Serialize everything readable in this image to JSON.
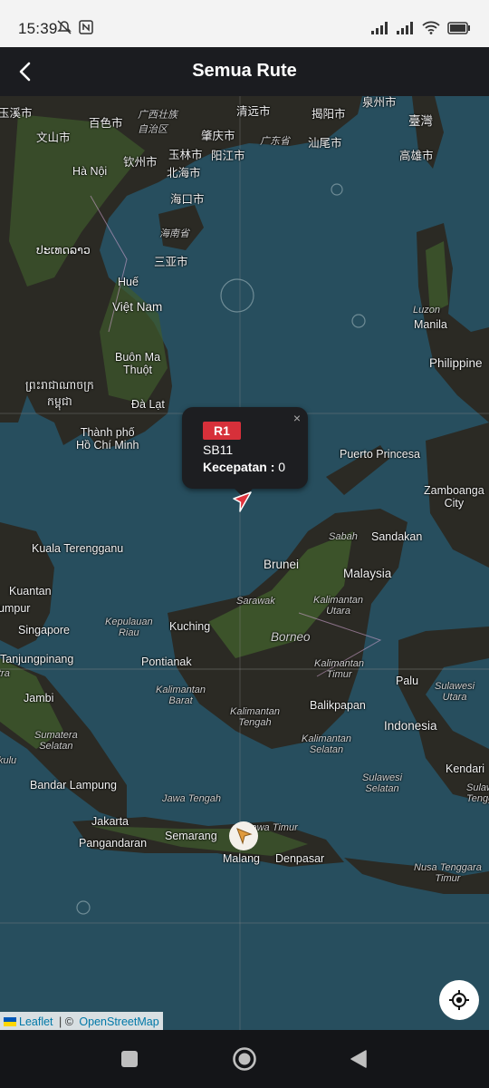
{
  "status_bar": {
    "time": "15:39"
  },
  "app_bar": {
    "title": "Semua Rute"
  },
  "map": {
    "labels": [
      {
        "id": "l1",
        "text": "玉溪市"
      },
      {
        "id": "l2",
        "text": "百色市"
      },
      {
        "id": "l3",
        "text": "广西壮族\n自治区"
      },
      {
        "id": "l4",
        "text": "清远市"
      },
      {
        "id": "l5",
        "text": "揭阳市"
      },
      {
        "id": "l6",
        "text": "泉州市"
      },
      {
        "id": "l7",
        "text": "臺灣"
      },
      {
        "id": "l8",
        "text": "文山市"
      },
      {
        "id": "l9",
        "text": "肇庆市"
      },
      {
        "id": "l10",
        "text": "广东省"
      },
      {
        "id": "l11",
        "text": "汕尾市"
      },
      {
        "id": "l12",
        "text": "玉林市"
      },
      {
        "id": "l13",
        "text": "阳江市"
      },
      {
        "id": "l14",
        "text": "钦州市"
      },
      {
        "id": "l15",
        "text": "北海市"
      },
      {
        "id": "l16",
        "text": "高雄市"
      },
      {
        "id": "l17",
        "text": "Hà Nội"
      },
      {
        "id": "l18",
        "text": "海口市"
      },
      {
        "id": "l19",
        "text": "海南省"
      },
      {
        "id": "l20",
        "text": "ປະເທດລາວ"
      },
      {
        "id": "l21",
        "text": "三亚市"
      },
      {
        "id": "l22",
        "text": "Huế"
      },
      {
        "id": "l23",
        "text": "Việt Nam"
      },
      {
        "id": "l24",
        "text": "Luzon"
      },
      {
        "id": "l25",
        "text": "Manila"
      },
      {
        "id": "l26",
        "text": "Philippine"
      },
      {
        "id": "l27",
        "text": "Buôn Ma\nThuột"
      },
      {
        "id": "l28",
        "text": "ព្រះរាជាណាចក្រ\nកម្ពុជា"
      },
      {
        "id": "l29",
        "text": "Đà Lạt"
      },
      {
        "id": "l30",
        "text": "Thành phố\nHồ Chí Minh"
      },
      {
        "id": "l31",
        "text": "Puerto Princesa"
      },
      {
        "id": "l32",
        "text": "Zamboanga\nCity"
      },
      {
        "id": "l33",
        "text": "Sabah"
      },
      {
        "id": "l34",
        "text": "Sandakan"
      },
      {
        "id": "l35",
        "text": "Kuala Terengganu"
      },
      {
        "id": "l36",
        "text": "Brunei"
      },
      {
        "id": "l37",
        "text": "Malaysia"
      },
      {
        "id": "l38",
        "text": "Kuantan"
      },
      {
        "id": "l39",
        "text": "umpur"
      },
      {
        "id": "l40",
        "text": "Sarawak"
      },
      {
        "id": "l41",
        "text": "Kalimantan\nUtara"
      },
      {
        "id": "l42",
        "text": "Singapore"
      },
      {
        "id": "l43",
        "text": "Kepulauan\nRiau"
      },
      {
        "id": "l44",
        "text": "Kuching"
      },
      {
        "id": "l45",
        "text": "Borneo"
      },
      {
        "id": "l46",
        "text": "Tanjungpinang"
      },
      {
        "id": "l47",
        "text": "Pontianak"
      },
      {
        "id": "l48",
        "text": "Kalimantan\nTimur"
      },
      {
        "id": "l49",
        "text": "tra"
      },
      {
        "id": "l50",
        "text": "Palu"
      },
      {
        "id": "l51",
        "text": "Sulawesi\nUtara"
      },
      {
        "id": "l52",
        "text": "Jambi"
      },
      {
        "id": "l53",
        "text": "Kalimantan\nBarat"
      },
      {
        "id": "l54",
        "text": "Kalimantan\nTengah"
      },
      {
        "id": "l55",
        "text": "Balikpapan"
      },
      {
        "id": "l56",
        "text": "Indonesia"
      },
      {
        "id": "l57",
        "text": "Sumatera\nSelatan"
      },
      {
        "id": "l58",
        "text": "Kalimantan\nSelatan"
      },
      {
        "id": "l59",
        "text": "kulu"
      },
      {
        "id": "l60",
        "text": "Kendari"
      },
      {
        "id": "l61",
        "text": "Sulawesi\nSelatan"
      },
      {
        "id": "l62",
        "text": "Sulaw\nTengg"
      },
      {
        "id": "l63",
        "text": "Bandar Lampung"
      },
      {
        "id": "l64",
        "text": "Jawa Tengah"
      },
      {
        "id": "l65",
        "text": "Jakarta"
      },
      {
        "id": "l66",
        "text": "Jawa Timur"
      },
      {
        "id": "l67",
        "text": "Semarang"
      },
      {
        "id": "l68",
        "text": "Pangandaran"
      },
      {
        "id": "l69",
        "text": "Malang"
      },
      {
        "id": "l70",
        "text": "Denpasar"
      },
      {
        "id": "l71",
        "text": "Nusa Tenggara\nTimur"
      }
    ]
  },
  "popup": {
    "route_badge": "R1",
    "vessel_name": "SB11",
    "speed_label": "Kecepatan :",
    "speed_value": "0",
    "close_glyph": "×"
  },
  "attribution": {
    "leaflet": "Leaflet",
    "separator": " | © ",
    "osm": "OpenStreetMap"
  },
  "colors": {
    "sea": "#274e5e",
    "land": "#2b2a24",
    "forest": "#3f5a2c",
    "accent_red": "#d7303a",
    "app_bar": "#1b1c20"
  }
}
